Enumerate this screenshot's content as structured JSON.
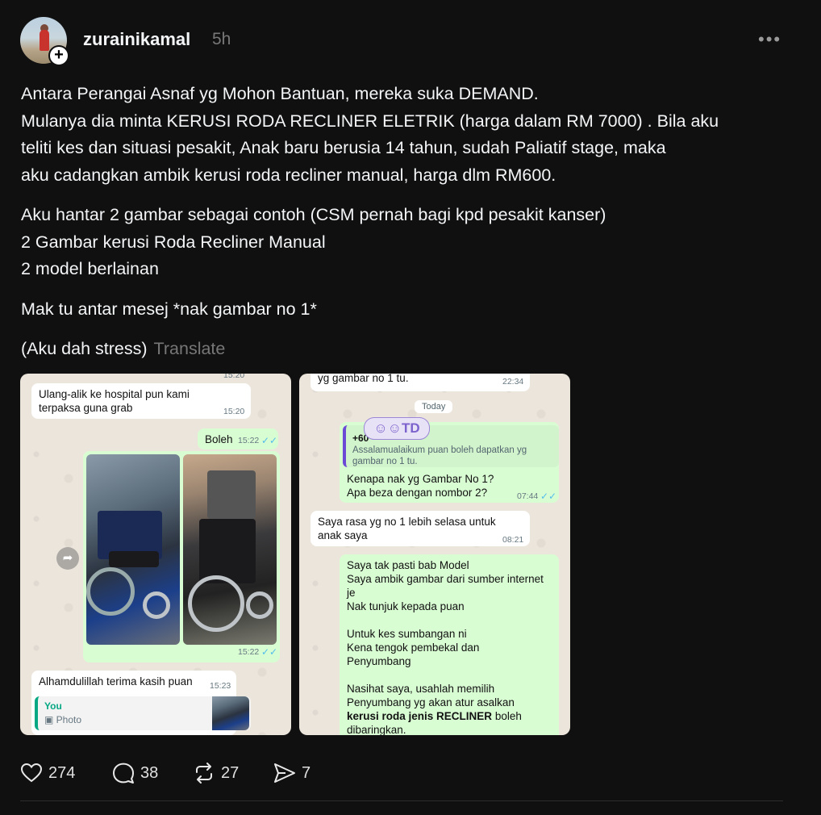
{
  "post": {
    "username": "zurainikamal",
    "time": "5h",
    "more": "•••",
    "follow_icon": "plus-icon",
    "text": {
      "p1_l1": "Antara Perangai Asnaf yg Mohon Bantuan, mereka suka DEMAND.",
      "p1_l2": "Mulanya dia minta KERUSI RODA RECLINER ELETRIK (harga dalam RM 7000) . Bila aku",
      "p1_l3": "teliti kes dan situasi pesakit, Anak baru berusia 14 tahun, sudah Paliatif stage, maka",
      "p1_l4": "aku cadangkan ambik kerusi roda recliner manual, harga dlm RM600.",
      "p2_l1": "Aku hantar 2 gambar sebagai contoh (CSM pernah bagi kpd pesakit kanser)",
      "p2_l2": "2 Gambar kerusi Roda Recliner Manual",
      "p2_l3": "2 model berlainan",
      "p3_l1": "Mak tu antar mesej *nak gambar no 1*",
      "p4_l1": "(Aku dah stress)"
    },
    "translate": "Translate"
  },
  "chat1": {
    "top_ts": "15:20",
    "msg1": "Ulang-alik ke hospital pun kami terpaksa guna grab",
    "msg1_ts": "15:20",
    "msg2": "Boleh",
    "msg2_ts": "15:22",
    "photos_ts": "15:22",
    "msg3": "Alhamdulillah terima kasih puan",
    "msg3_ts": "15:23",
    "reply_author": "You",
    "reply_type": "Photo",
    "tick": "✓✓"
  },
  "chat2": {
    "top_msg": "yg gambar no 1 tu.",
    "top_ts": "22:34",
    "date_chip": "Today",
    "badge": "☺☺TD",
    "quote_phone": "+60",
    "quote_text": "Assalamualaikum puan boleh dapatkan yg gambar no 1 tu.",
    "reply_l1": "Kenapa nak yg Gambar No 1?",
    "reply_l2": "Apa beza dengan nombor 2?",
    "reply_ts": "07:44",
    "msg_in": "Saya rasa yg no 1 lebih selasa untuk anak saya",
    "msg_in_ts": "08:21",
    "long_l1": "Saya tak pasti bab Model",
    "long_l2": "Saya ambik gambar dari sumber internet je",
    "long_l3": "Nak tunjuk kepada puan",
    "long_l4": "Untuk kes sumbangan ni",
    "long_l5": "Kena tengok pembekal dan",
    "long_l6": "Penyumbang",
    "long_l7": "Nasihat saya, usahlah memilih",
    "long_l8": "Penyumbang yg akan atur asalkan",
    "long_bold": "kerusi roda jenis RECLINER",
    "long_l9_rest": " boleh",
    "long_l10": "dibaringkan.",
    "tick": "✓✓"
  },
  "actions": {
    "likes": "274",
    "comments": "38",
    "reposts": "27",
    "shares": "7",
    "like_icon": "heart-icon",
    "comment_icon": "comment-icon",
    "repost_icon": "repost-icon",
    "share_icon": "send-icon"
  }
}
